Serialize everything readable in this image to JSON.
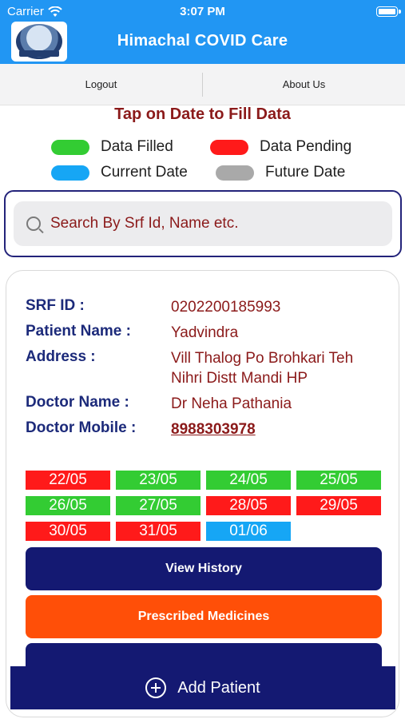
{
  "status_bar": {
    "carrier": "Carrier",
    "time": "3:07 PM"
  },
  "header": {
    "title": "Himachal COVID Care"
  },
  "subnav": {
    "logout": "Logout",
    "about": "About Us"
  },
  "instruction": "Tap on Date to Fill Data",
  "legend": [
    {
      "label": "Data Filled",
      "color": "#33cc33"
    },
    {
      "label": "Data Pending",
      "color": "#ff1a1a"
    },
    {
      "label": "Current Date",
      "color": "#16a6f5"
    },
    {
      "label": "Future Date",
      "color": "#a9a9a9"
    }
  ],
  "search": {
    "placeholder": "Search By Srf Id, Name etc."
  },
  "patient": {
    "srf_label": "SRF ID :",
    "srf_value": "0202200185993",
    "name_label": "Patient Name :",
    "name_value": "Yadvindra",
    "address_label": "Address :",
    "address_value": "Vill Thalog Po Brohkari Teh Nihri Distt Mandi HP",
    "doctor_label": "Doctor Name :",
    "doctor_value": "Dr Neha Pathania",
    "mobile_label": "Doctor Mobile :",
    "mobile_value": "8988303978"
  },
  "dates": [
    {
      "label": "22/05",
      "status": "pending"
    },
    {
      "label": "23/05",
      "status": "filled"
    },
    {
      "label": "24/05",
      "status": "filled"
    },
    {
      "label": "25/05",
      "status": "filled"
    },
    {
      "label": "26/05",
      "status": "filled"
    },
    {
      "label": "27/05",
      "status": "filled"
    },
    {
      "label": "28/05",
      "status": "pending"
    },
    {
      "label": "29/05",
      "status": "pending"
    },
    {
      "label": "30/05",
      "status": "pending"
    },
    {
      "label": "31/05",
      "status": "pending"
    },
    {
      "label": "01/06",
      "status": "current"
    }
  ],
  "status_colors": {
    "filled": "#33cc33",
    "pending": "#ff1a1a",
    "current": "#16a6f5",
    "future": "#a9a9a9"
  },
  "buttons": {
    "view_history": "View History",
    "prescribed_medicines": "Prescribed Medicines",
    "add_patient": "Add Patient"
  },
  "colors": {
    "header_blue": "#2196f3",
    "navy": "#141972",
    "orange": "#ff4f08",
    "maroon": "#8b1a1a"
  }
}
